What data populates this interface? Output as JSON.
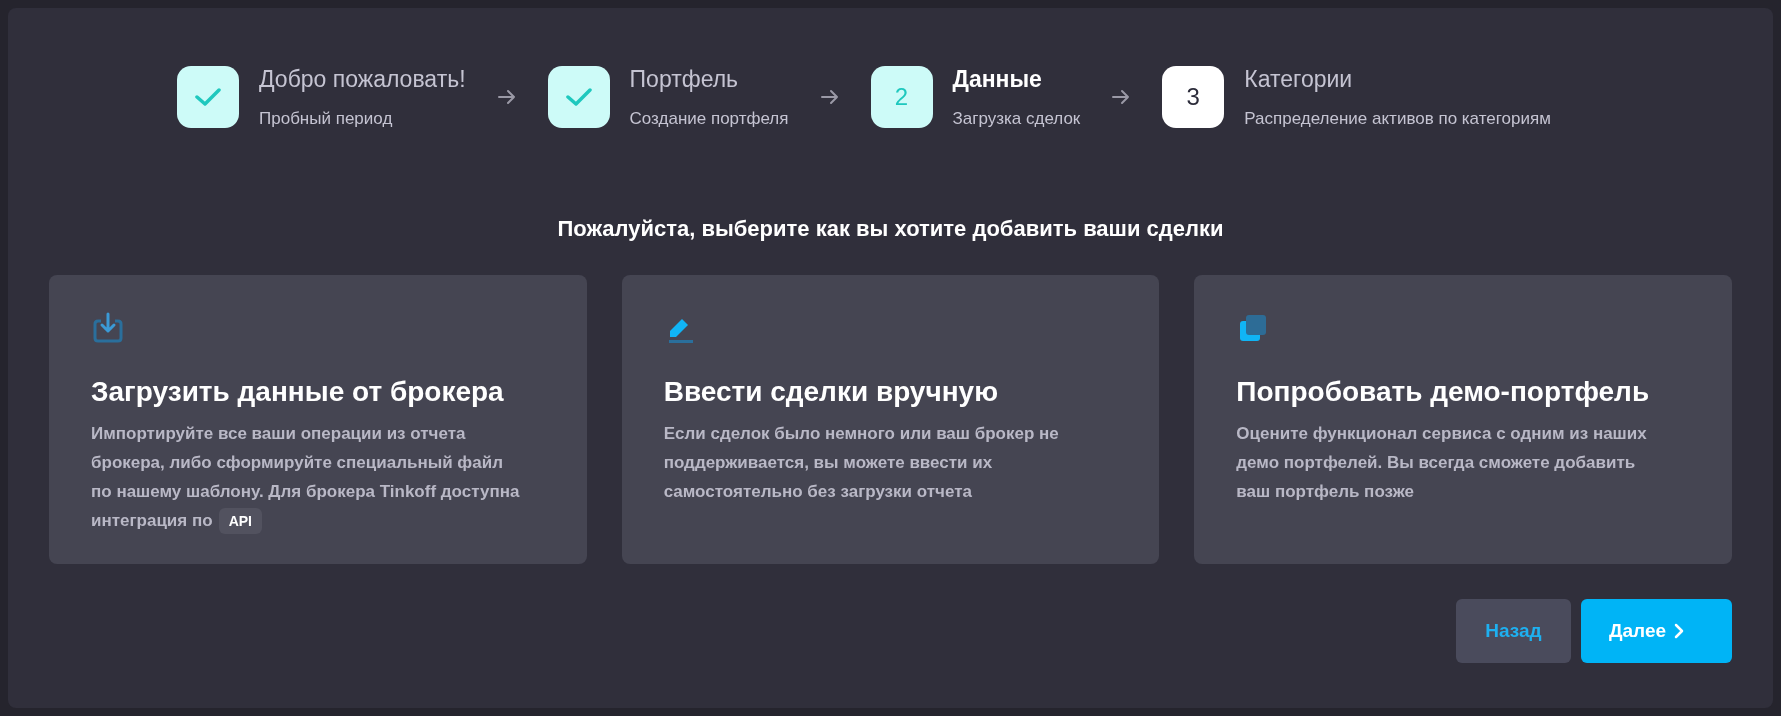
{
  "steps": [
    {
      "title": "Добро пожаловать!",
      "subtitle": "Пробный период",
      "completed": true,
      "selected": false
    },
    {
      "title": "Портфель",
      "subtitle": "Создание портфеля",
      "completed": true,
      "selected": false
    },
    {
      "title": "Данные",
      "subtitle": "Загрузка сделок",
      "completed": false,
      "selected": true,
      "number": "2"
    },
    {
      "title": "Категории",
      "subtitle": "Распределение активов по категориям",
      "completed": false,
      "selected": false,
      "number": "3"
    }
  ],
  "heading": "Пожалуйста, выберите как вы хотите добавить ваши сделки",
  "options": [
    {
      "kind": "upload",
      "title": "Загрузить данные от брокера",
      "description": "Импортируйте все ваши операции из отчета брокера, либо сформируйте специальный файл по нашему шаблону. Для брокера Tinkoff доступна интеграция по",
      "badge": "API"
    },
    {
      "kind": "manual",
      "title": "Ввести сделки вручную",
      "description": "Если сделок было немного или ваш брокер не поддерживается, вы можете ввести их самостоятельно без загрузки отчета"
    },
    {
      "kind": "demo",
      "title": "Попробовать демо-портфель",
      "description": "Оцените функционал сервиса с одним из наших демо портфелей. Вы всегда сможете добавить ваш портфель позже"
    }
  ],
  "buttons": {
    "back": "Назад",
    "next": "Далее"
  }
}
